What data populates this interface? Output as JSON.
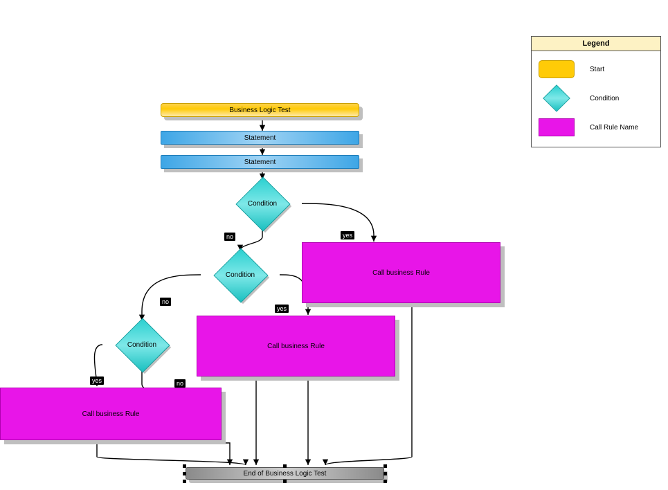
{
  "title": "Business Logic Test",
  "nodes": {
    "start": "Business Logic Test",
    "stmt1": "Statement",
    "stmt2": "Statement",
    "cond1": "Condition",
    "cond2": "Condition",
    "cond3": "Condition",
    "call1": "Call business Rule",
    "call2": "Call business Rule",
    "call3": "Call business Rule",
    "end": "End of Business Logic Test"
  },
  "edgeLabels": {
    "yes": "yes",
    "no": "no"
  },
  "legend": {
    "title": "Legend",
    "start": "Start",
    "condition": "Condition",
    "call": "Call Rule Name"
  }
}
